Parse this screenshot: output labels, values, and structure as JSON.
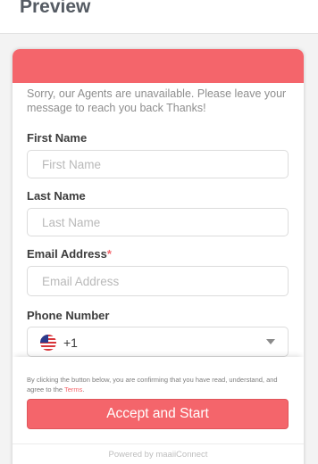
{
  "page": {
    "title": "Preview"
  },
  "widget": {
    "header_color": "#f4656b",
    "notice": "Sorry, our Agents are unavailable. Please leave your message to reach you back Thanks!"
  },
  "form": {
    "first_name": {
      "label": "First Name",
      "placeholder": "First Name",
      "value": ""
    },
    "last_name": {
      "label": "Last Name",
      "placeholder": "Last Name",
      "value": ""
    },
    "email": {
      "label": "Email Address",
      "required_mark": "*",
      "placeholder": "Email Address",
      "value": ""
    },
    "phone": {
      "label": "Phone Number",
      "country_icon": "us-flag-icon",
      "dial_code": "+1"
    }
  },
  "footer": {
    "consent_text": "By clicking the button below, you are confirming that you have read, understand, and agree to the ",
    "terms_label": "Terms",
    "consent_end": ".",
    "accept_label": "Accept and Start",
    "powered_by": "Powered by maaiiConnect"
  },
  "colors": {
    "accent": "#f4656b",
    "label_text": "#3c3c3c",
    "muted_text": "#8e8e8e"
  }
}
